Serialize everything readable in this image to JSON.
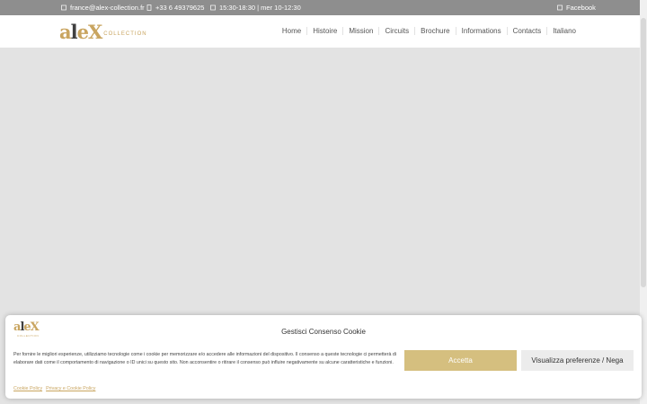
{
  "topbar": {
    "email": "france@alex-collection.fr",
    "phone": "+33 6 49379625",
    "hours": "15:30-18:30 | mer 10-12:30",
    "social": "Facebook"
  },
  "logo": {
    "text_dark": "a",
    "text_l": "l",
    "text_rest": "eX",
    "suffix": "COLLECTION"
  },
  "nav": {
    "items": [
      "Home",
      "Histoire",
      "Mission",
      "Circuits",
      "Brochure",
      "Informations",
      "Contacts",
      "Italiano"
    ]
  },
  "consent": {
    "title": "Gestisci Consenso Cookie",
    "text": "Per fornire le migliori esperienze, utilizziamo tecnologie come i cookie per memorizzare e/o accedere alle informazioni del dispositivo. Il consenso a queste tecnologie ci permetterà di elaborare dati come il comportamento di navigazione o ID unici su questo sito. Non acconsentire o ritirare il consenso può influire negativamente su alcune caratteristiche e funzioni.",
    "accept_label": "Accetta",
    "prefs_label": "Visualizza preferenze / Nega",
    "link_cookie": "Cookie Policy",
    "link_privacy": "Privacy e Cookie Policy"
  },
  "colors": {
    "accent": "#c9a560",
    "topbar": "#8e8e8e",
    "accept_button": "#d5bf7f"
  }
}
